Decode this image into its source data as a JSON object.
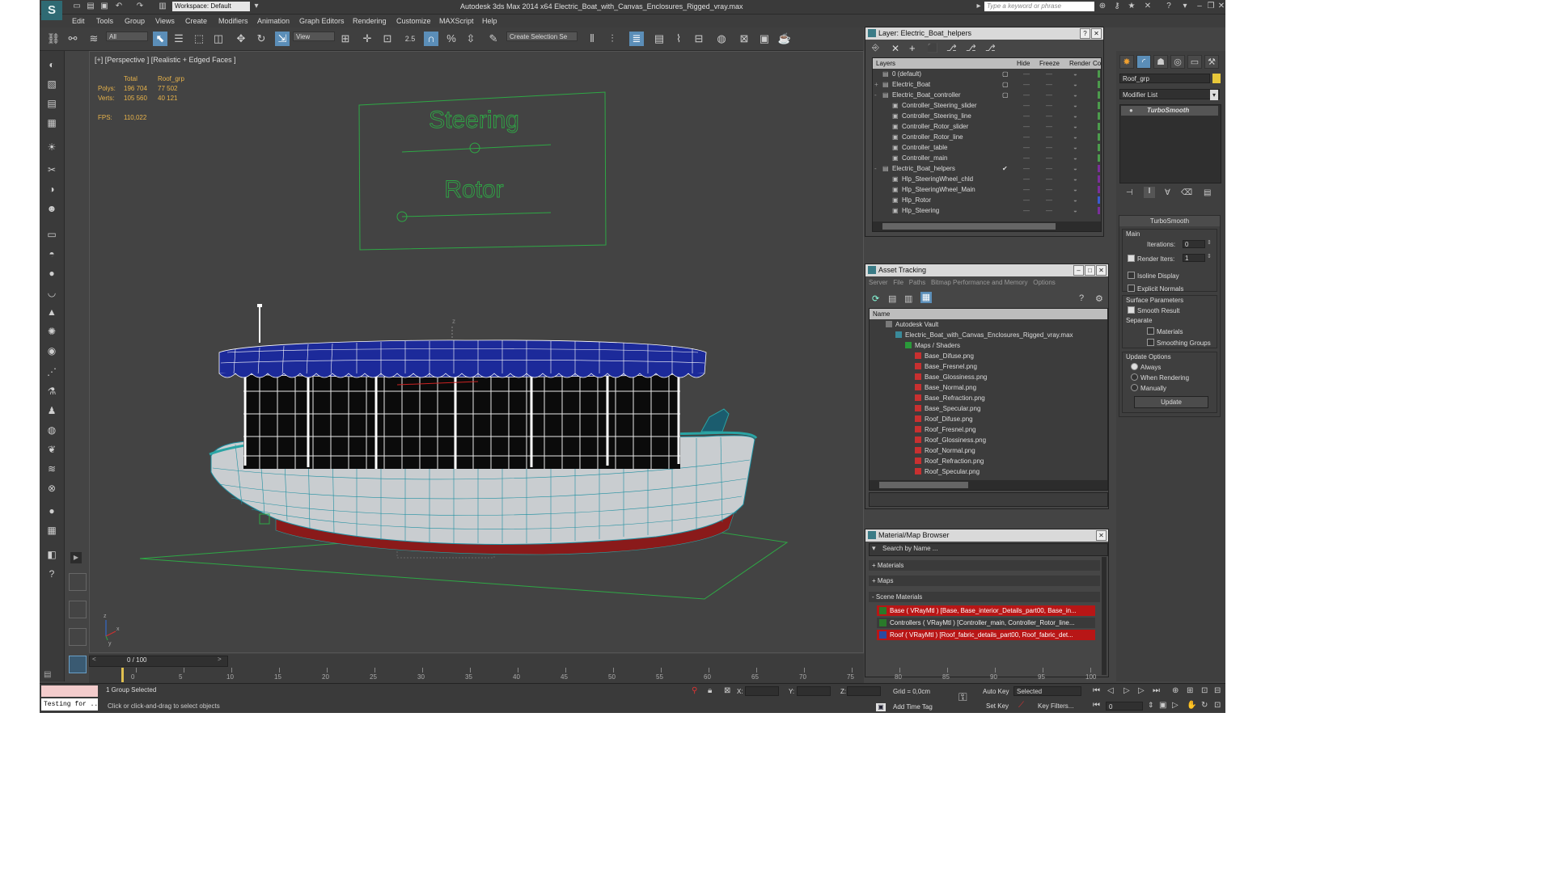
{
  "app": {
    "title": "Autodesk 3ds Max  2014 x64     Electric_Boat_with_Canvas_Enclosures_Rigged_vray.max",
    "workspace": "Workspace: Default",
    "search_placeholder": "Type a keyword or phrase",
    "logo_glyph": "S"
  },
  "menu": [
    "Edit",
    "Tools",
    "Group",
    "Views",
    "Create",
    "Modifiers",
    "Animation",
    "Graph Editors",
    "Rendering",
    "Customize",
    "MAXScript",
    "Help"
  ],
  "toolbar": {
    "selection_filter": "All",
    "ref_coord": "View",
    "snap_value": "2.5",
    "named_selection": "Create Selection Se"
  },
  "viewport": {
    "label": "[+] [Perspective ] [Realistic + Edged Faces ]",
    "stats": {
      "col_total": "Total",
      "col_sel": "Roof_grp",
      "polys_label": "Polys:",
      "polys_total": "196 704",
      "polys_sel": "77 502",
      "verts_label": "Verts:",
      "verts_total": "105 560",
      "verts_sel": "40 121",
      "fps_label": "FPS:",
      "fps_value": "110,022"
    },
    "controller_labels": [
      "Steering",
      "Rotor"
    ],
    "axis_labels": {
      "y": "y",
      "z": "z",
      "x": "x"
    },
    "boat_pivot_label": "z"
  },
  "layer_window": {
    "title": "Layer: Electric_Boat_helpers",
    "columns": [
      "Layers",
      "Hide",
      "Freeze",
      "Render",
      "Co"
    ],
    "rows": [
      {
        "label": "0 (default)",
        "level": 0,
        "expander": "",
        "checked": false
      },
      {
        "label": "Electric_Boat",
        "level": 0,
        "expander": "+",
        "checked": false
      },
      {
        "label": "Electric_Boat_controller",
        "level": 0,
        "expander": "-",
        "checked": false
      },
      {
        "label": "Controller_Steering_slider",
        "level": 1,
        "expander": "",
        "checked": false
      },
      {
        "label": "Controller_Steering_line",
        "level": 1,
        "expander": "",
        "checked": false
      },
      {
        "label": "Controller_Rotor_slider",
        "level": 1,
        "expander": "",
        "checked": false
      },
      {
        "label": "Controller_Rotor_line",
        "level": 1,
        "expander": "",
        "checked": false
      },
      {
        "label": "Controller_table",
        "level": 1,
        "expander": "",
        "checked": false
      },
      {
        "label": "Controller_main",
        "level": 1,
        "expander": "",
        "checked": false
      },
      {
        "label": "Electric_Boat_helpers",
        "level": 0,
        "expander": "-",
        "checked": true
      },
      {
        "label": "Hlp_SteeringWheel_chld",
        "level": 1,
        "expander": "",
        "checked": false
      },
      {
        "label": "Hlp_SteeringWheel_Main",
        "level": 1,
        "expander": "",
        "checked": false
      },
      {
        "label": "Hlp_Rotor",
        "level": 1,
        "expander": "",
        "checked": false
      },
      {
        "label": "Hlp_Steering",
        "level": 1,
        "expander": "",
        "checked": false
      }
    ],
    "color_swatches": [
      "#4c9b4c",
      "#4c9b4c",
      "#4c9b4c",
      "#4c9b4c",
      "#4c9b4c",
      "#4c9b4c",
      "#4c9b4c",
      "#4c9b4c",
      "#4c9b4c",
      "#7a2f9a",
      "#7a2f9a",
      "#7a2f9a",
      "#3a5bd0",
      "#7a2f9a"
    ]
  },
  "asset_window": {
    "title": "Asset Tracking",
    "menu": [
      "Server",
      "File",
      "Paths",
      "Bitmap Performance and Memory",
      "Options"
    ],
    "column": "Name",
    "rows": [
      {
        "label": "Autodesk Vault",
        "level": 1
      },
      {
        "label": "Electric_Boat_with_Canvas_Enclosures_Rigged_vray.max",
        "level": 2
      },
      {
        "label": "Maps / Shaders",
        "level": 3
      },
      {
        "label": "Base_Difuse.png",
        "level": 4
      },
      {
        "label": "Base_Fresnel.png",
        "level": 4
      },
      {
        "label": "Base_Glossiness.png",
        "level": 4
      },
      {
        "label": "Base_Normal.png",
        "level": 4
      },
      {
        "label": "Base_Refraction.png",
        "level": 4
      },
      {
        "label": "Base_Specular.png",
        "level": 4
      },
      {
        "label": "Roof_Difuse.png",
        "level": 4
      },
      {
        "label": "Roof_Fresnel.png",
        "level": 4
      },
      {
        "label": "Roof_Glossiness.png",
        "level": 4
      },
      {
        "label": "Roof_Normal.png",
        "level": 4
      },
      {
        "label": "Roof_Refraction.png",
        "level": 4
      },
      {
        "label": "Roof_Specular.png",
        "level": 4
      }
    ]
  },
  "material_window": {
    "title": "Material/Map Browser",
    "search": "Search by Name ...",
    "sections": [
      "+ Materials",
      "+ Maps",
      "- Scene Materials"
    ],
    "materials": [
      "Base  ( VRayMtl ) [Base, Base_interior_Details_part00, Base_in...",
      "Controllers  ( VRayMtl ) [Controller_main, Controller_Rotor_line...",
      "Roof  ( VRayMtl ) [Roof_fabric_details_part00, Roof_fabric_det..."
    ]
  },
  "command_panel": {
    "object_name": "Roof_grp",
    "modifier_list": "Modifier List",
    "stack_item": "TurboSmooth",
    "rollout_title": "TurboSmooth",
    "main_label": "Main",
    "iterations_label": "Iterations:",
    "iterations_value": "0",
    "render_iters_label": "Render Iters:",
    "render_iters_value": "1",
    "isoline": "Isoline Display",
    "explicit_normals": "Explicit Normals",
    "surface_params": "Surface Parameters",
    "smooth_result": "Smooth Result",
    "separate": "Separate",
    "materials": "Materials",
    "smoothing_groups": "Smoothing Groups",
    "update_options": "Update Options",
    "always": "Always",
    "when_rendering": "When Rendering",
    "manually": "Manually",
    "update_btn": "Update",
    "object_color": "#e8c83a"
  },
  "timeline": {
    "frame": "0 / 100",
    "ticks": [
      "0",
      "5",
      "10",
      "15",
      "20",
      "25",
      "30",
      "35",
      "40",
      "45",
      "50",
      "55",
      "60",
      "65",
      "70",
      "75",
      "80",
      "85",
      "90",
      "95",
      "100"
    ]
  },
  "status": {
    "maxscript": "Testing for ...",
    "selected": "1 Group Selected",
    "prompt": "Click or click-and-drag to select objects",
    "x_label": "X:",
    "y_label": "Y:",
    "z_label": "Z:",
    "grid": "Grid = 0,0cm",
    "add_time_tag": "Add Time Tag",
    "auto_key": "Auto Key",
    "set_key": "Set Key",
    "key_mode": "Selected",
    "key_filters": "Key Filters...",
    "frame_field": "0"
  }
}
